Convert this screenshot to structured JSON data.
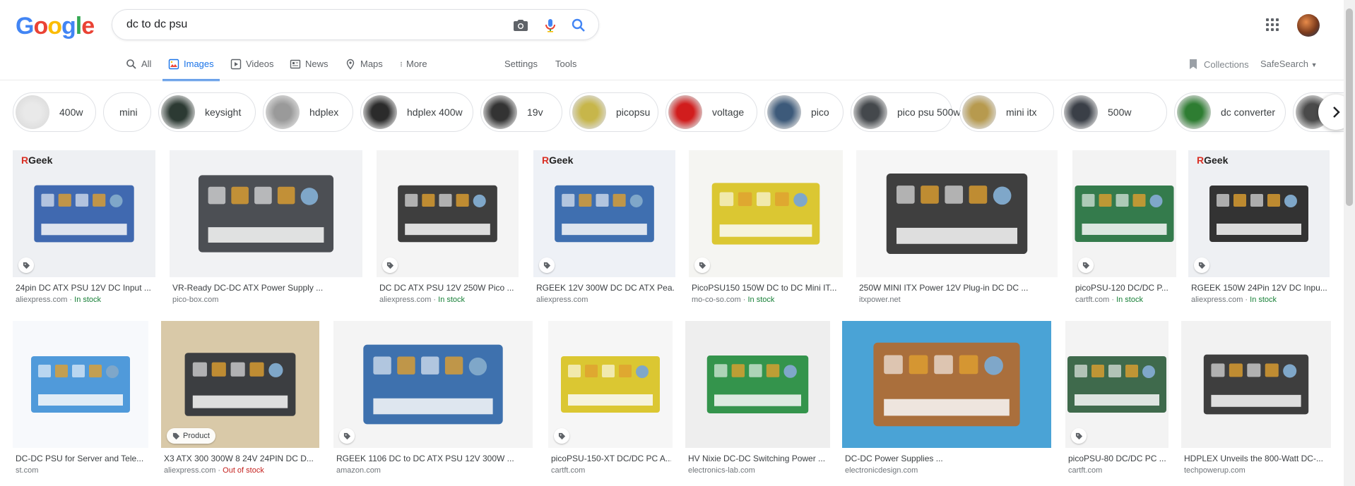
{
  "logo": {
    "letters": [
      "G",
      "o",
      "o",
      "g",
      "l",
      "e"
    ],
    "colors": [
      "#4285f4",
      "#ea4335",
      "#fbbc05",
      "#4285f4",
      "#34a853",
      "#ea4335"
    ]
  },
  "search": {
    "query": "dc to dc psu"
  },
  "nav": {
    "tabs": [
      {
        "label": "All",
        "icon": "search-icon"
      },
      {
        "label": "Images",
        "icon": "image-icon",
        "active": true
      },
      {
        "label": "Videos",
        "icon": "video-icon"
      },
      {
        "label": "News",
        "icon": "news-icon"
      },
      {
        "label": "Maps",
        "icon": "map-pin-icon"
      },
      {
        "label": "More",
        "icon": "more-vert-icon"
      }
    ],
    "settings": "Settings",
    "tools": "Tools",
    "collections": "Collections",
    "safesearch": "SafeSearch"
  },
  "chips": [
    {
      "label": "400w",
      "thumb": "#e9e9e9"
    },
    {
      "label": "mini",
      "thumb": ""
    },
    {
      "label": "keysight",
      "thumb": "#2c3a33"
    },
    {
      "label": "hdplex",
      "thumb": "#9a9a9a"
    },
    {
      "label": "hdplex 400w",
      "thumb": "#2b2b2b"
    },
    {
      "label": "19v",
      "thumb": "#333"
    },
    {
      "label": "picopsu",
      "thumb": "#c7b64a"
    },
    {
      "label": "voltage",
      "thumb": "#d11d1d"
    },
    {
      "label": "pico",
      "thumb": "#3d5a7a"
    },
    {
      "label": "pico psu 500w",
      "thumb": "#44484c"
    },
    {
      "label": "mini itx",
      "thumb": "#b79a4e"
    },
    {
      "label": "500w",
      "thumb": "#3a3f47"
    },
    {
      "label": "dc converter",
      "thumb": "#2e7d32"
    },
    {
      "label": "",
      "thumb": "#4a4a4a"
    }
  ],
  "results_row1": [
    {
      "title": "24pin DC ATX PSU 12V DC Input ...",
      "source": "aliexpress.com",
      "stock": "In stock",
      "bg": "#eef0f3",
      "fg": "#2c5aa8",
      "rgeek": true,
      "tag": true
    },
    {
      "title": "VR-Ready DC-DC ATX Power Supply ...",
      "source": "pico-box.com",
      "stock": "",
      "bg": "#f1f2f4",
      "fg": "#3a3d42",
      "rgeek": false,
      "tag": false
    },
    {
      "title": "DC DC ATX PSU 12V 250W Pico ...",
      "source": "aliexpress.com",
      "stock": "In stock",
      "bg": "#f4f4f4",
      "fg": "#2a2a2a",
      "rgeek": false,
      "tag": true
    },
    {
      "title": "RGEEK 12V 300W DC DC ATX Pea...",
      "source": "aliexpress.com",
      "stock": "",
      "bg": "#eef1f6",
      "fg": "#2b61a8",
      "rgeek": true,
      "tag": true
    },
    {
      "title": "PicoPSU150 150W DC to DC Mini IT...",
      "source": "mo-co-so.com",
      "stock": "In stock",
      "bg": "#f5f5f2",
      "fg": "#d8c21d",
      "rgeek": false,
      "tag": true
    },
    {
      "title": "250W MINI ITX Power 12V Plug-in DC DC ...",
      "source": "itxpower.net",
      "stock": "",
      "bg": "#f6f6f6",
      "fg": "#2b2b2b",
      "rgeek": false,
      "tag": false
    },
    {
      "title": "picoPSU-120 DC/DC P...",
      "source": "cartft.com",
      "stock": "In stock",
      "bg": "#f3f3f3",
      "fg": "#1f6e3a",
      "rgeek": false,
      "tag": true
    },
    {
      "title": "RGEEK 150W 24Pin 12V DC Inpu...",
      "source": "aliexpress.com",
      "stock": "In stock",
      "bg": "#eef0f3",
      "fg": "#1e1e1e",
      "rgeek": true,
      "tag": true
    }
  ],
  "results_row2": [
    {
      "title": "DC-DC PSU for Server and Tele...",
      "source": "st.com",
      "stock": "",
      "bg": "#f7f9fc",
      "fg": "#3d8fd6",
      "tag": false,
      "product": false
    },
    {
      "title": "X3 ATX 300 300W 8 24V 24PIN DC D...",
      "source": "aliexpress.com",
      "stock": "Out of stock",
      "bg": "#d9c9a8",
      "fg": "#2a2f35",
      "tag": false,
      "product": true,
      "product_label": "Product"
    },
    {
      "title": "RGEEK 1106 DC to DC ATX PSU 12V 300W ...",
      "source": "amazon.com",
      "stock": "",
      "bg": "#f4f4f4",
      "fg": "#2a63a6",
      "tag": true,
      "product": false
    },
    {
      "title": "picoPSU-150-XT DC/DC PC A...",
      "source": "cartft.com",
      "stock": "",
      "bg": "#f6f6f6",
      "fg": "#d8c21d",
      "tag": true,
      "product": false
    },
    {
      "title": "HV Nixie DC-DC Switching Power ...",
      "source": "electronics-lab.com",
      "stock": "",
      "bg": "#eeeeee",
      "fg": "#1f8a3a",
      "tag": false,
      "product": false
    },
    {
      "title": "DC-DC Power Supplies ...",
      "source": "electronicdesign.com",
      "stock": "",
      "bg": "#4aa3d6",
      "fg": "#b5692b",
      "tag": false,
      "product": false
    },
    {
      "title": "picoPSU-80 DC/DC PC ...",
      "source": "cartft.com",
      "stock": "",
      "bg": "#f3f3f3",
      "fg": "#2b5b3a",
      "tag": true,
      "product": false
    },
    {
      "title": "HDPLEX Unveils the 800-Watt DC-...",
      "source": "techpowerup.com",
      "stock": "",
      "bg": "#f2f2f2",
      "fg": "#2a2a2a",
      "tag": false,
      "product": false
    }
  ]
}
